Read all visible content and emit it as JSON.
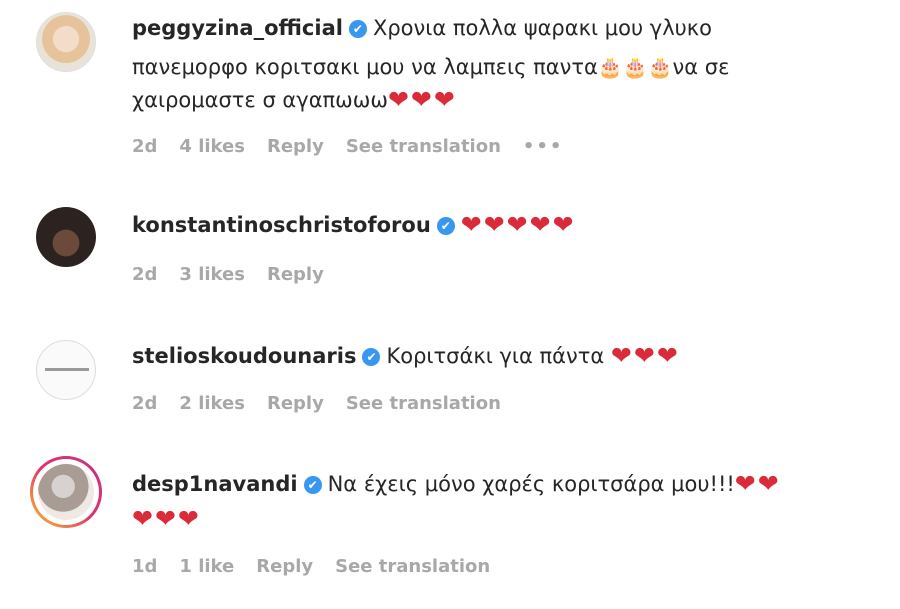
{
  "comments": [
    {
      "username": "peggyzina_official",
      "text_line1": "Χρονια πολλα ψαρακι μου γλυκο",
      "text_line2": "πανεμορφο κοριτσακι μου να λαμπεις παντα",
      "cakes": "🎂🎂🎂",
      "text_line2b": "να σε",
      "text_line3": "χαιρομαστε σ αγαπωωω",
      "hearts": "❤❤❤",
      "time": "2d",
      "likes": "4 likes",
      "reply": "Reply",
      "translate": "See translation",
      "more": "•••"
    },
    {
      "username": "konstantinoschristoforou",
      "hearts": "❤❤❤❤❤",
      "time": "2d",
      "likes": "3 likes",
      "reply": "Reply"
    },
    {
      "username": "stelioskoudounaris",
      "text": "Κοριτσάκι για πάντα",
      "hearts": "❤❤❤",
      "time": "2d",
      "likes": "2 likes",
      "reply": "Reply",
      "translate": "See translation"
    },
    {
      "username": "desp1navandi",
      "text": "Να έχεις μόνο χαρές κοριτσάρα μου!!!",
      "hearts_inline": "❤❤",
      "hearts_line2": "❤❤❤",
      "time": "1d",
      "likes": "1 like",
      "reply": "Reply",
      "translate": "See translation"
    }
  ],
  "icons": {
    "verified": "✔"
  },
  "colors": {
    "heart": "#d92b3a",
    "verified": "#3897f0",
    "meta": "#a8a8a8"
  }
}
